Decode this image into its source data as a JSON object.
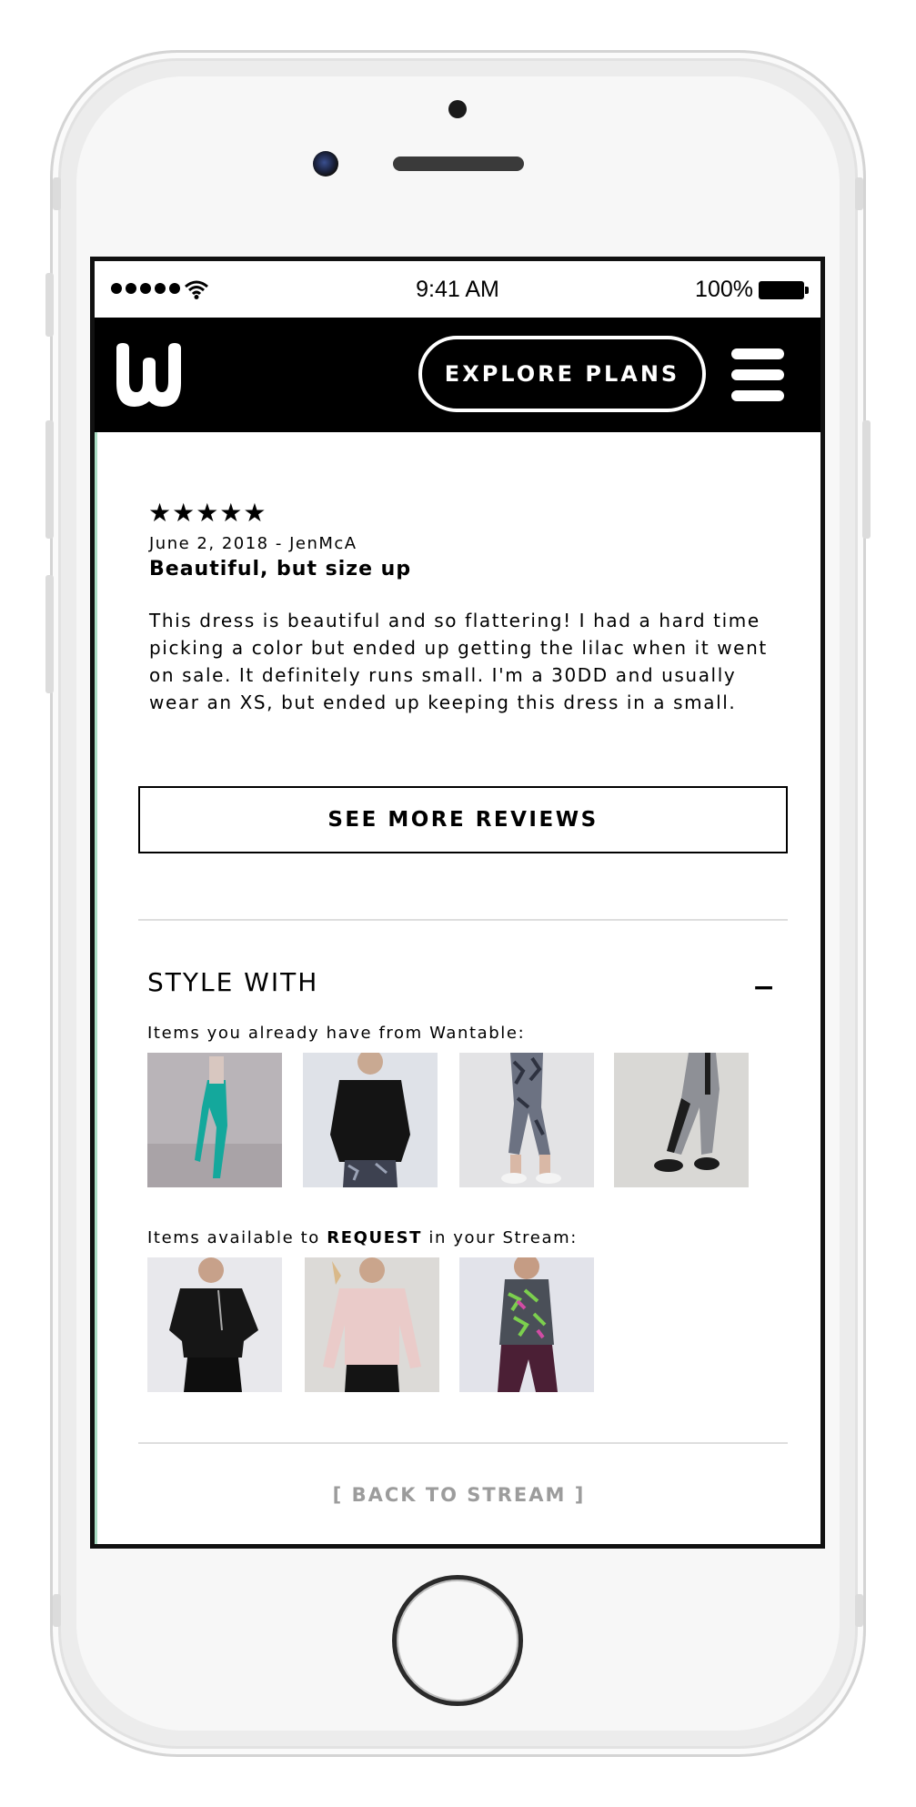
{
  "statusbar": {
    "time": "9:41 AM",
    "battery": "100%",
    "wifi_glyph": "◠"
  },
  "navbar": {
    "explore_label": "EXPLORE PLANS"
  },
  "review": {
    "stars": "★★★★★",
    "rating": 5,
    "meta": "June 2, 2018 - JenMcA",
    "title": "Beautiful, but size up",
    "body": "This dress is beautiful and so flattering! I had a hard time picking a color but ended up getting the lilac when it went on sale. It definitely runs small. I'm a 30DD and usually wear an XS, but ended up keeping this dress in a small."
  },
  "see_more_label": "SEE MORE REVIEWS",
  "style_with": {
    "title": "STYLE WITH",
    "collapse_glyph": "−",
    "owned_label": "Items you already have from Wantable:",
    "request_prefix": "Items available to ",
    "request_bold": "REQUEST",
    "request_suffix": " in your Stream:"
  },
  "back_link": "[ BACK TO STREAM ]",
  "colors": {
    "accent_border": "#a9dcc3",
    "navbar": "#000000",
    "muted_text": "#9c9c9c"
  }
}
